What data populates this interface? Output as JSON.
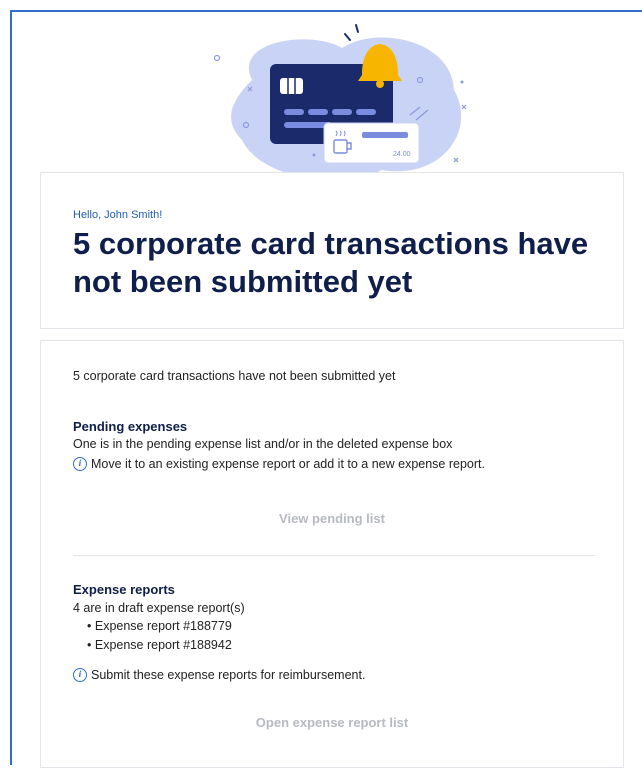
{
  "illustration": {
    "amount": "24.00"
  },
  "header": {
    "greeting": "Hello, John Smith!",
    "headline": "5 corporate card transactions have not been submitted yet"
  },
  "summary": "5 corporate card transactions have not been submitted yet",
  "pending": {
    "title": "Pending expenses",
    "text": "One is in the pending expense list and/or in the deleted expense box",
    "tip": "Move it to an existing expense report or add it to a new expense report.",
    "button_label": "View pending list"
  },
  "reports": {
    "title": "Expense reports",
    "text": "4 are in draft expense report(s)",
    "items": [
      {
        "label": "Expense report #188779"
      },
      {
        "label": "Expense report #188942"
      }
    ],
    "tip": "Submit these expense reports for reimbursement.",
    "button_label": "Open expense report list"
  },
  "colors": {
    "accent": "#2f6fc9",
    "headline": "#0f1e4a",
    "disabled_link": "#b7bac2",
    "card_dark": "#1b2a6b",
    "bell": "#f7b500"
  },
  "icons": {
    "info": "info-circle-icon",
    "bell": "bell-icon",
    "card": "credit-card-icon",
    "coffee": "coffee-cup-icon"
  }
}
